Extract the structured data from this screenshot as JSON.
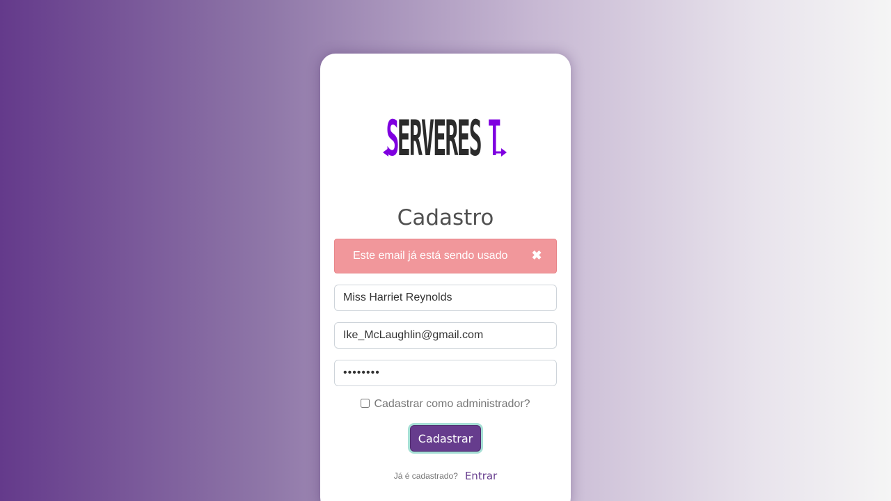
{
  "logo": {
    "text": "SERVEREST",
    "accent_color": "#7f00e0"
  },
  "form": {
    "title": "Cadastro",
    "alert": {
      "message": "Este email já está sendo usado",
      "close_icon": "close-icon",
      "color": "#f1979b"
    },
    "name_value": "Miss Harriet Reynolds",
    "email_value": "Ike_McLaughlin@gmail.com",
    "password_value": "********",
    "admin_checkbox": {
      "label": "Cadastrar como administrador?",
      "checked": false
    },
    "submit_label": "Cadastrar",
    "login_prompt": "Já é cadastrado?",
    "login_link": "Entrar"
  },
  "colors": {
    "primary": "#663c8d",
    "focus_ring": "#a6dfd5",
    "background_start": "#643a8b",
    "background_end": "#f5f5f5"
  }
}
